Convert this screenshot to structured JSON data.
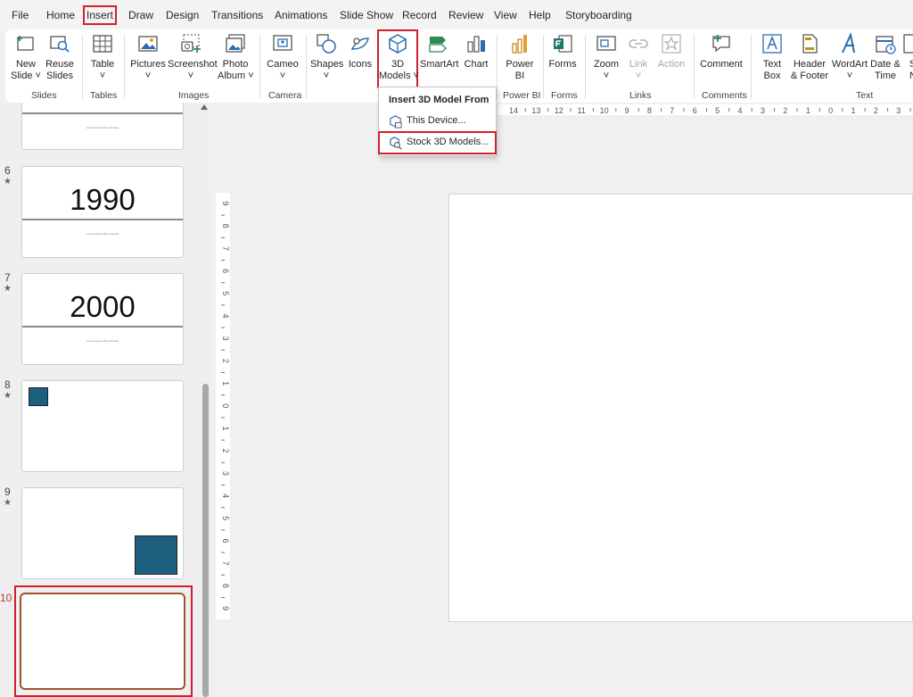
{
  "tabs": [
    "File",
    "Home",
    "Insert",
    "Draw",
    "Design",
    "Transitions",
    "Animations",
    "Slide Show",
    "Record",
    "Review",
    "View",
    "Help",
    "Storyboarding"
  ],
  "ribbon": {
    "new_slide": "New Slide",
    "new_slide_l1": "New",
    "new_slide_l2": "Slide ˅",
    "reuse_slides_l1": "Reuse",
    "reuse_slides_l2": "Slides",
    "group_slides": "Slides",
    "table_l1": "Table",
    "table_l2": "˅",
    "group_tables": "Tables",
    "pictures_l1": "Pictures",
    "pictures_l2": "˅",
    "screenshot_l1": "Screenshot",
    "screenshot_l2": "˅",
    "photo_album_l1": "Photo",
    "photo_album_l2": "Album ˅",
    "group_images": "Images",
    "cameo_l1": "Cameo",
    "cameo_l2": "˅",
    "group_camera": "Camera",
    "shapes_l1": "Shapes",
    "shapes_l2": "˅",
    "icons": "Icons",
    "models_l1": "3D",
    "models_l2": "Models ˅",
    "smartart": "SmartArt",
    "chart": "Chart",
    "powerbi_l1": "Power",
    "powerbi_l2": "BI",
    "group_powerbi": "Power BI",
    "forms": "Forms",
    "group_forms": "Forms",
    "zoom_l1": "Zoom",
    "zoom_l2": "˅",
    "link_l1": "Link",
    "link_l2": "˅",
    "action": "Action",
    "group_links": "Links",
    "comment": "Comment",
    "group_comments": "Comments",
    "textbox_l1": "Text",
    "textbox_l2": "Box",
    "header_l1": "Header",
    "header_l2": "& Footer",
    "wordart_l1": "WordArt",
    "wordart_l2": "˅",
    "datetime_l1": "Date &",
    "datetime_l2": "Time",
    "slidenum_l1": "S",
    "slidenum_l2": "N",
    "group_text": "Text"
  },
  "dropdown": {
    "title": "Insert 3D Model From",
    "items": [
      "This Device...",
      "Stock 3D Models..."
    ]
  },
  "thumbnails": {
    "slide5_sub": "Lorem ipsum dolor sit amet",
    "slide6_num": "6",
    "slide6_title": "1990",
    "slide6_sub": "Lorem ipsum dolor sit amet",
    "slide7_num": "7",
    "slide7_title": "2000",
    "slide7_sub": "Lorem ipsum dolor sit amet",
    "slide8_num": "8",
    "slide9_num": "9",
    "slide10_num": "10",
    "star": "★"
  },
  "rulers": {
    "horizontal": [
      "14",
      "13",
      "12",
      "11",
      "10",
      "9",
      "8",
      "7",
      "6",
      "5",
      "4",
      "3",
      "2",
      "1",
      "0",
      "1",
      "2",
      "3"
    ],
    "vertical": [
      "9",
      "8",
      "7",
      "6",
      "5",
      "4",
      "3",
      "2",
      "1",
      "0",
      "1",
      "2",
      "3",
      "4",
      "5",
      "6",
      "7",
      "8",
      "9"
    ]
  },
  "colors": {
    "highlight_red": "#d0202a",
    "shape_blue": "#1c5f7f",
    "slide10_number": "#c0392b",
    "slide10_border": "#a0522d"
  }
}
